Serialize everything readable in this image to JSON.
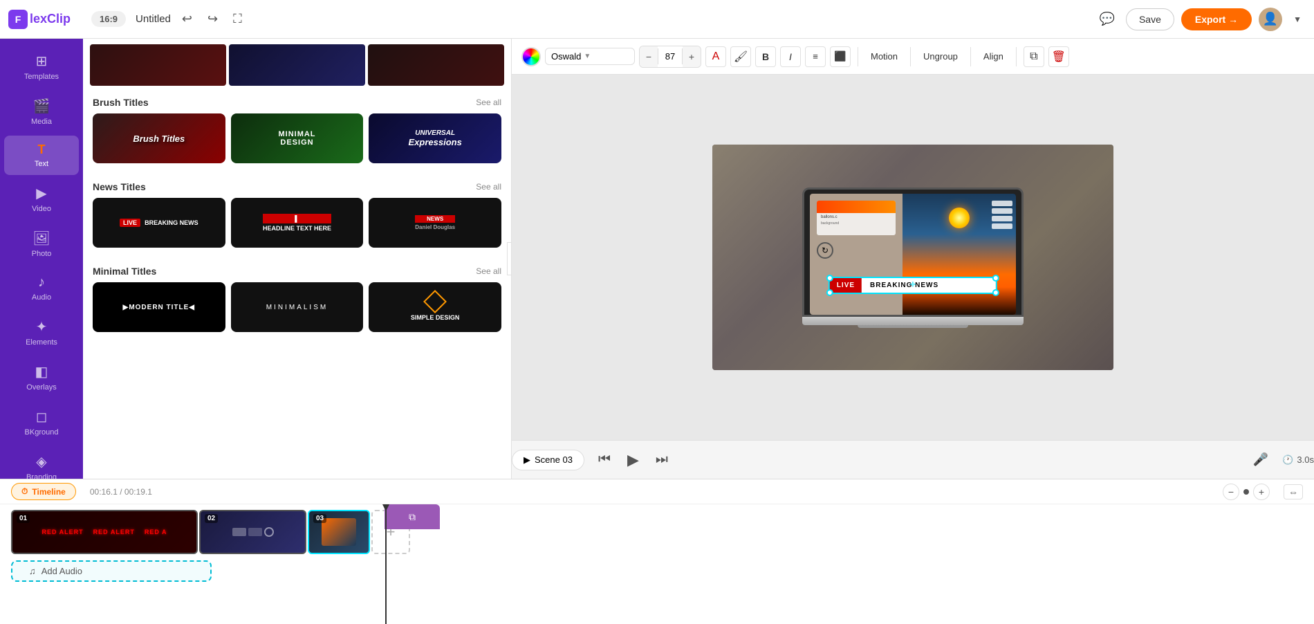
{
  "app": {
    "name": "FlexClip",
    "logo_letter": "F"
  },
  "topbar": {
    "aspect_ratio": "16:9",
    "project_title": "Untitled",
    "save_label": "Save",
    "export_label": "Export →"
  },
  "sidebar": {
    "items": [
      {
        "id": "templates",
        "label": "Templates",
        "icon": "⊞"
      },
      {
        "id": "media",
        "label": "Media",
        "icon": "🎬"
      },
      {
        "id": "text",
        "label": "Text",
        "icon": "T",
        "active": true
      },
      {
        "id": "video",
        "label": "Video",
        "icon": "▶"
      },
      {
        "id": "photo",
        "label": "Photo",
        "icon": "🖼"
      },
      {
        "id": "audio",
        "label": "Audio",
        "icon": "♪"
      },
      {
        "id": "elements",
        "label": "Elements",
        "icon": "✦"
      },
      {
        "id": "overlays",
        "label": "Overlays",
        "icon": "◧"
      },
      {
        "id": "bkground",
        "label": "BKground",
        "icon": "◻"
      },
      {
        "id": "branding",
        "label": "Branding",
        "icon": "◈"
      }
    ]
  },
  "panel": {
    "brush_titles": {
      "section": "Brush Titles",
      "see_all": "See all",
      "cards": [
        {
          "label": "Brush Titles",
          "style": "brush-1"
        },
        {
          "label": "MINIMAL DESIGN",
          "style": "brush-2"
        },
        {
          "label": "UNIVERSAL Expressions",
          "style": "brush-3"
        }
      ]
    },
    "news_titles": {
      "section": "News Titles",
      "see_all": "See all",
      "cards": [
        {
          "label": "LIVE BREAKING NEWS",
          "style": "news-1"
        },
        {
          "label": "HEADLINE TEXT HERE",
          "style": "news-2"
        },
        {
          "label": "NEWS",
          "style": "news-3"
        }
      ]
    },
    "minimal_titles": {
      "section": "Minimal Titles",
      "see_all": "See all",
      "cards": [
        {
          "label": "▶MODERN TITLE◀",
          "style": "minimal-1"
        },
        {
          "label": "MINIMALISM",
          "style": "minimal-2"
        },
        {
          "label": "SIMPLE DESIGN",
          "style": "minimal-3"
        }
      ]
    }
  },
  "format_toolbar": {
    "font_name": "Oswald",
    "font_size": "87",
    "bold_label": "B",
    "italic_label": "I",
    "motion_label": "Motion",
    "ungroup_label": "Ungroup",
    "align_label": "Align"
  },
  "canvas": {
    "breaking_news_live": "LIVE",
    "breaking_news_text": "BREAKING NEWS"
  },
  "player": {
    "scene_label": "Scene 03",
    "timer_label": "3.0s"
  },
  "timeline": {
    "tab_label": "Timeline",
    "time_current": "00:16.1",
    "time_total": "00:19.1",
    "add_audio_label": "Add Audio",
    "clips": [
      {
        "number": "01",
        "type": "red-alert"
      },
      {
        "number": "02",
        "type": "blue"
      },
      {
        "number": "03",
        "type": "news"
      }
    ]
  }
}
